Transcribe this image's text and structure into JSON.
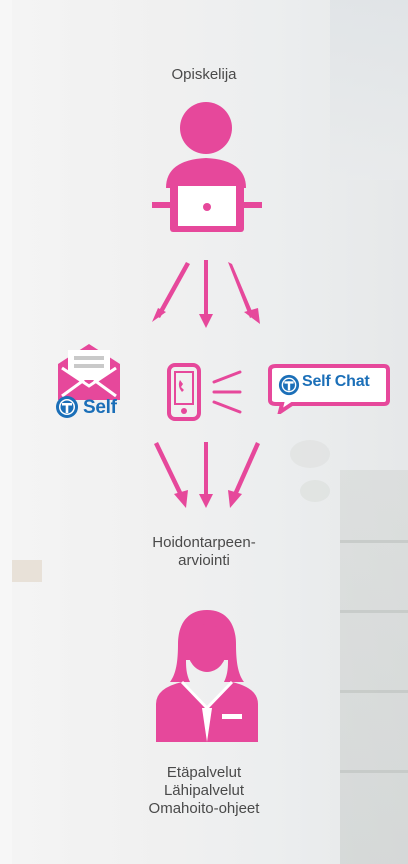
{
  "top_label": "Opiskelija",
  "middle_label": "Hoidontarpeen-\narviointi",
  "bottom_labels": [
    "Etäpalvelut",
    "Lähipalvelut",
    "Omahoito-ohjeet"
  ],
  "self_brand": "Self",
  "self_chat_brand": "Self Chat",
  "colors": {
    "accent": "#e6489b",
    "brand_blue": "#1b6fb8",
    "text": "#4a4a4a"
  },
  "icons": [
    "student-laptop-icon",
    "envelope-icon",
    "phone-icon",
    "chat-bubble-icon",
    "nurse-icon",
    "arrow-icon"
  ]
}
